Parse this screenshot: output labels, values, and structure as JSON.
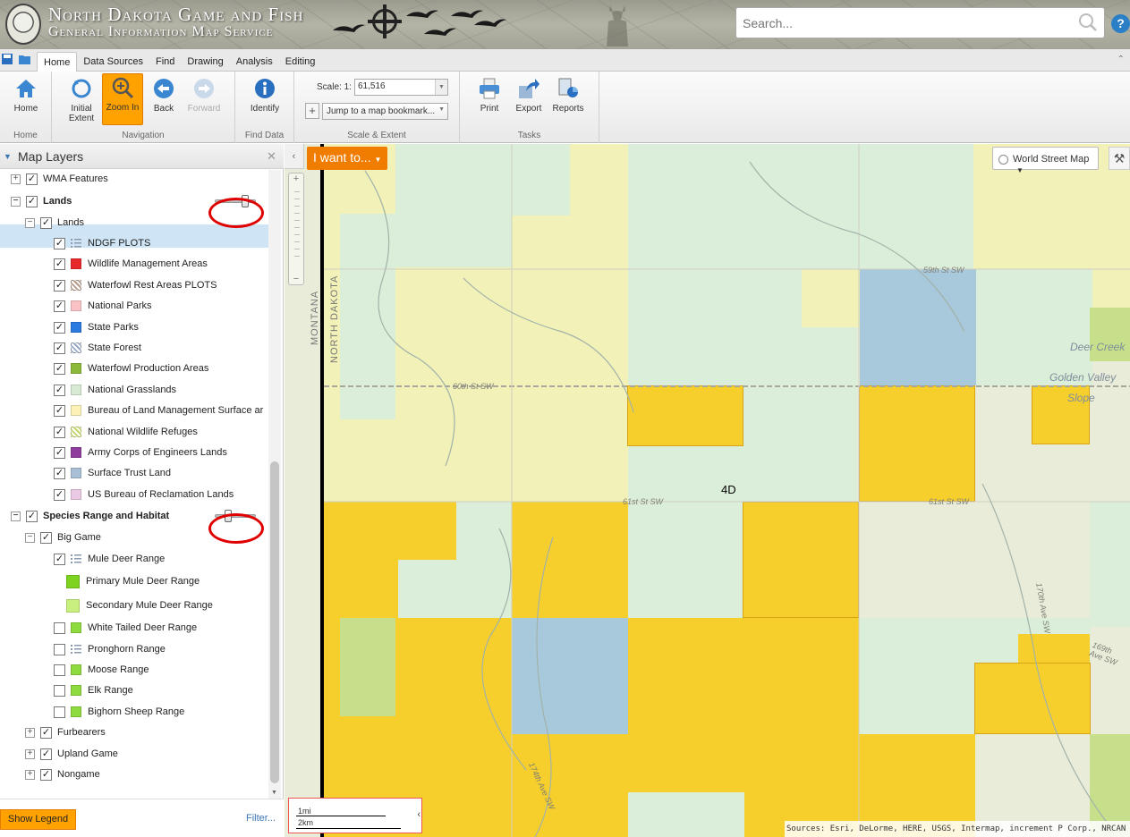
{
  "banner": {
    "title_line1": "North Dakota Game and Fish",
    "title_line2": "General Information Map Service"
  },
  "search": {
    "placeholder": "Search..."
  },
  "help": {
    "label": "?"
  },
  "ribbon": {
    "tabs": [
      "Home",
      "Data Sources",
      "Find",
      "Drawing",
      "Analysis",
      "Editing"
    ],
    "active_tab": "Home",
    "groups": {
      "home": {
        "label": "Home",
        "buttons": {
          "home": "Home"
        }
      },
      "navigation": {
        "label": "Navigation",
        "buttons": {
          "initial_extent_1": "Initial",
          "initial_extent_2": "Extent",
          "zoom_in": "Zoom In",
          "back": "Back",
          "forward": "Forward"
        }
      },
      "find_data": {
        "label": "Find Data",
        "buttons": {
          "identify": "Identify"
        }
      },
      "scale_extent": {
        "label": "Scale & Extent",
        "scale_label": "Scale: 1:",
        "scale_value": "61,516",
        "bookmark_placeholder": "Jump to a map bookmark..."
      },
      "tasks": {
        "label": "Tasks",
        "buttons": {
          "print": "Print",
          "export": "Export",
          "reports": "Reports"
        }
      }
    }
  },
  "panel": {
    "title": "Map Layers",
    "layers": [
      {
        "label": "WMA Features",
        "level": 0,
        "expander": "+",
        "checked": true
      },
      {
        "label": "Lands",
        "level": 0,
        "expander": "−",
        "checked": true,
        "bold": true,
        "selected": true,
        "opacity": 0.8
      },
      {
        "label": "Lands",
        "level": 1,
        "expander": "−",
        "checked": true
      },
      {
        "label": "NDGF PLOTS",
        "level": 2,
        "checked": true,
        "icon": "legend-list-icon"
      },
      {
        "label": "Wildlife Management Areas",
        "level": 2,
        "checked": true,
        "color": "#e8292c"
      },
      {
        "label": "Waterfowl Rest Areas PLOTS",
        "level": 2,
        "checked": true,
        "color": "#b89a88",
        "pattern": "hatch"
      },
      {
        "label": "National Parks",
        "level": 2,
        "checked": true,
        "color": "#f9c3c6"
      },
      {
        "label": "State Parks",
        "level": 2,
        "checked": true,
        "color": "#2a7ae0"
      },
      {
        "label": "State Forest",
        "level": 2,
        "checked": true,
        "color": "#9aa8c8",
        "pattern": "hatch"
      },
      {
        "label": "Waterfowl Production Areas",
        "level": 2,
        "checked": true,
        "color": "#8db93a"
      },
      {
        "label": "National Grasslands",
        "level": 2,
        "checked": true,
        "color": "#d8ead4"
      },
      {
        "label": "Bureau of Land Management Surface ar",
        "level": 2,
        "checked": true,
        "color": "#fdf1b5"
      },
      {
        "label": "National Wildlife Refuges",
        "level": 2,
        "checked": true,
        "color": "#c4d66a",
        "pattern": "hatch"
      },
      {
        "label": "Army Corps of Engineers Lands",
        "level": 2,
        "checked": true,
        "color": "#8e3d9d"
      },
      {
        "label": "Surface Trust Land",
        "level": 2,
        "checked": true,
        "color": "#a9bfd6"
      },
      {
        "label": "US Bureau of Reclamation Lands",
        "level": 2,
        "checked": true,
        "color": "#e9c9e3"
      },
      {
        "label": "Species Range and Habitat",
        "level": 0,
        "expander": "−",
        "checked": true,
        "bold": true,
        "opacity": 0.3
      },
      {
        "label": "Big Game",
        "level": 1,
        "expander": "−",
        "checked": true
      },
      {
        "label": "Mule Deer Range",
        "level": 2,
        "checked": true,
        "icon": "legend-list-icon"
      },
      {
        "label": "Primary Mule Deer Range",
        "level": 3,
        "color": "#7ed321",
        "large": true
      },
      {
        "label": "Secondary Mule Deer Range",
        "level": 3,
        "color": "#c9f07e",
        "large": true
      },
      {
        "label": "White Tailed Deer Range",
        "level": 2,
        "checked": false,
        "color": "#8ddb3e"
      },
      {
        "label": "Pronghorn Range",
        "level": 2,
        "checked": false,
        "icon": "legend-list-icon"
      },
      {
        "label": "Moose Range",
        "level": 2,
        "checked": false,
        "color": "#8ddb3e"
      },
      {
        "label": "Elk Range",
        "level": 2,
        "checked": false,
        "color": "#8ddb3e"
      },
      {
        "label": "Bighorn Sheep Range",
        "level": 2,
        "checked": false,
        "color": "#8ddb3e"
      },
      {
        "label": "Furbearers",
        "level": 1,
        "expander": "+",
        "checked": true
      },
      {
        "label": "Upland Game",
        "level": 1,
        "expander": "+",
        "checked": true
      },
      {
        "label": "Nongame",
        "level": 1,
        "expander": "+",
        "checked": true
      }
    ],
    "show_legend": "Show Legend",
    "filter": "Filter..."
  },
  "map": {
    "i_want_to": "I want to...",
    "basemap": "World Street Map",
    "state_labels": {
      "west": "MONTANA",
      "east": "NORTH DAKOTA"
    },
    "road_labels": [
      "59th St SW",
      "60th St SW",
      "61st St SW",
      "61st St SW",
      "170th Ave SW",
      "174th Ave SW",
      "169th Ave SW"
    ],
    "unit_label": "4D",
    "place_labels": {
      "deer_creek": "Deer Creek",
      "golden_valley": "Golden Valley",
      "slope": "Slope"
    },
    "scale_bar": {
      "miles": "1mi",
      "km": "2km"
    },
    "attribution": "Sources: Esri, DeLorme, HERE, USGS, Intermap, increment P Corp., NRCAN"
  },
  "colors": {
    "accent_orange": "#ffa200",
    "plots_yellow": "#f7cf2c",
    "grassland_green": "#d8ead4",
    "blm_yellow": "#f1f1b3",
    "trust_blue": "#a8c8dc"
  }
}
